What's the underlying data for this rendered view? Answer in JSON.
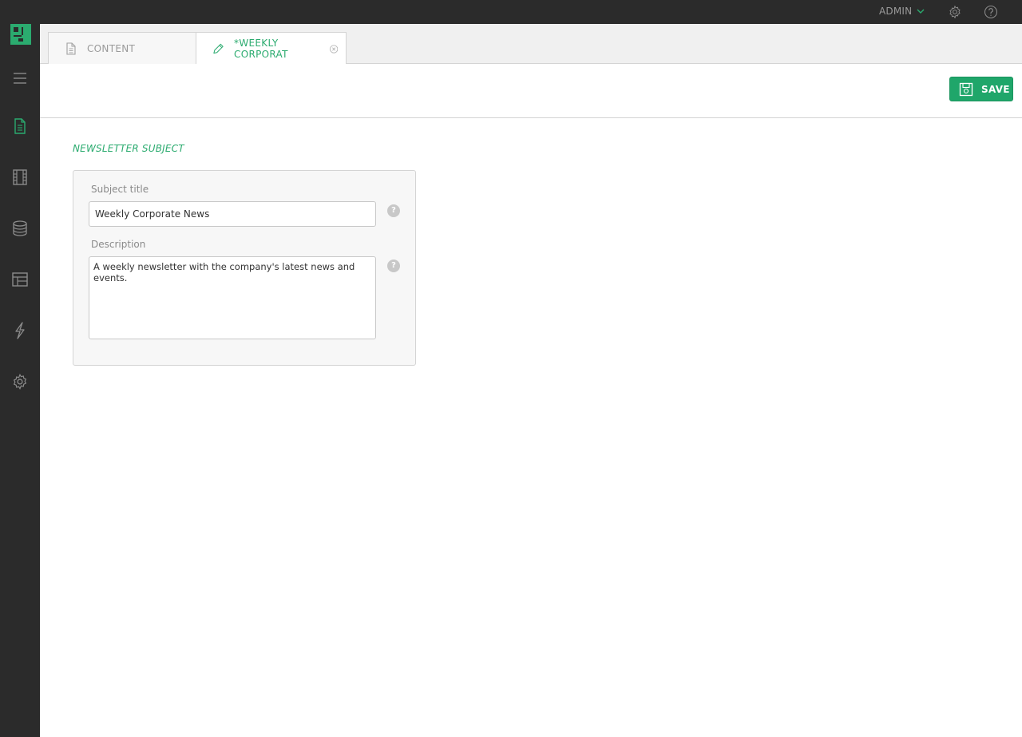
{
  "header": {
    "user_label": "ADMIN",
    "icons": [
      "chevron-down-icon",
      "gear-icon",
      "help-icon"
    ]
  },
  "sidebar": {
    "logo": "app-logo",
    "items": [
      {
        "name": "menu",
        "icon": "hamburger-icon",
        "active": false
      },
      {
        "name": "content",
        "icon": "document-icon",
        "active": true
      },
      {
        "name": "media",
        "icon": "film-icon",
        "active": false
      },
      {
        "name": "data",
        "icon": "database-icon",
        "active": false
      },
      {
        "name": "layouts",
        "icon": "layout-icon",
        "active": false
      },
      {
        "name": "actions",
        "icon": "lightning-icon",
        "active": false
      },
      {
        "name": "settings",
        "icon": "gear-icon",
        "active": false
      }
    ]
  },
  "tabs": [
    {
      "label": "CONTENT",
      "icon": "document-icon",
      "active": false
    },
    {
      "label": "*WEEKLY CORPORAT",
      "icon": "pencil-icon",
      "active": true,
      "closable": true
    }
  ],
  "toolbar": {
    "save_label": "SAVE"
  },
  "form": {
    "section_title": "NEWSLETTER SUBJECT",
    "subject_label": "Subject title",
    "subject_value": "Weekly Corporate News",
    "description_label": "Description",
    "description_value": "A weekly newsletter with the company's latest news and events.",
    "help_glyph": "?"
  },
  "colors": {
    "accent": "#2bab6f",
    "save_button": "#1fa66a",
    "sidebar_bg": "#2b2b2b",
    "icon_gray": "#8c8c8c"
  }
}
